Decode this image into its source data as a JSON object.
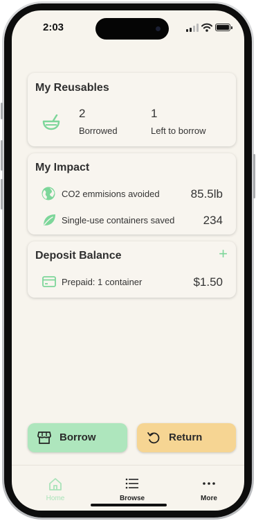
{
  "status_bar": {
    "time": "2:03"
  },
  "reusables": {
    "title": "My Reusables",
    "borrowed_count": "2",
    "borrowed_label": "Borrowed",
    "left_count": "1",
    "left_label": "Left to borrow"
  },
  "impact": {
    "title": "My Impact",
    "items": [
      {
        "label": "CO2 emmisions avoided",
        "value": "85.5lb",
        "icon": "globe-icon"
      },
      {
        "label": "Single-use containers saved",
        "value": "234",
        "icon": "leaf-icon"
      }
    ]
  },
  "deposit": {
    "title": "Deposit Balance",
    "add_symbol": "+",
    "prepaid_label": "Prepaid: 1 container",
    "prepaid_value": "$1.50"
  },
  "actions": {
    "borrow_label": "Borrow",
    "return_label": "Return"
  },
  "tabs": [
    {
      "label": "Home",
      "icon": "home-icon",
      "active": true
    },
    {
      "label": "Browse",
      "icon": "list-icon",
      "active": false
    },
    {
      "label": "More",
      "icon": "more-icon",
      "active": false
    }
  ],
  "colors": {
    "green": "#7dd69a",
    "borrow_bg": "#aee6bd",
    "return_bg": "#f6d593",
    "background": "#f7f4ed"
  }
}
